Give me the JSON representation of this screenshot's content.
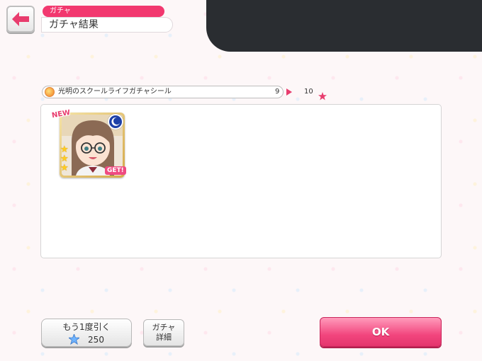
{
  "header": {
    "back_icon": "arrow-left-icon",
    "category_tag": "ガチャ",
    "title": "ガチャ結果"
  },
  "gacha": {
    "name": "光明のスクールライフガチャシール",
    "count_from": "9",
    "count_to": "10"
  },
  "results": [
    {
      "badge_new": "NEW",
      "badge_get": "GET!",
      "rarity": 3,
      "attribute_icon": "moon-icon"
    }
  ],
  "buttons": {
    "draw_again_label": "もう1度引く",
    "draw_again_cost": "250",
    "details_line1": "ガチャ",
    "details_line2": "詳細",
    "ok_label": "OK"
  },
  "colors": {
    "accent": "#f2386f",
    "ok_button": "#f2467e",
    "redacted": "#2a2d31"
  }
}
